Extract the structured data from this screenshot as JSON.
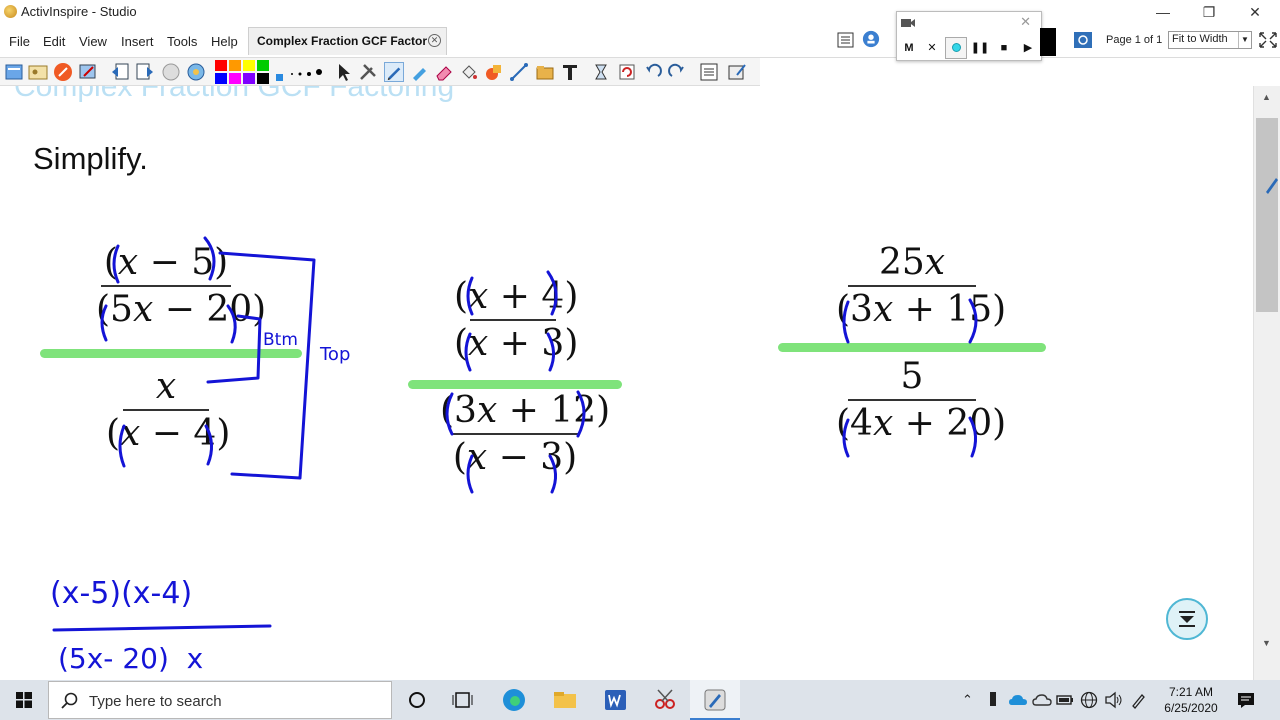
{
  "window": {
    "title": "ActivInspire - Studio",
    "controls": [
      "minimize",
      "restore",
      "close"
    ]
  },
  "menu": [
    "File",
    "Edit",
    "View",
    "Insert",
    "Tools",
    "Help"
  ],
  "tab": {
    "label": "Complex Fraction GCF Factoring"
  },
  "page_indicator": "Page 1 of 1",
  "zoom": {
    "selected": "Fit to Width"
  },
  "recorder": {
    "mute_label": "M",
    "close_label": "✕"
  },
  "toolbar": {
    "palette_colors": [
      "#ff0000",
      "#ff9900",
      "#ffff00",
      "#00cc00",
      "#0000ff",
      "#ff00ff",
      "#7f00ff",
      "#000000"
    ]
  },
  "canvas": {
    "heading": "Complex Fraction GCF Factoring",
    "instruction": "Simplify.",
    "problem1": {
      "top": {
        "num": "(x − 5)",
        "den": "(5x − 20)"
      },
      "bottom": {
        "num": "x",
        "den": "(x − 4)"
      },
      "annotation_btm": "Btm",
      "annotation_top": "Top"
    },
    "problem2": {
      "top": {
        "num": "(x + 4)",
        "den": "(x + 3)"
      },
      "bottom": {
        "num": "(3x + 12)",
        "den": "(x − 3)"
      }
    },
    "problem3": {
      "top": {
        "num": "25x",
        "den": "(3x + 15)"
      },
      "bottom": {
        "num": "5",
        "den": "(4x + 20)"
      }
    },
    "work": {
      "numerator": "(x-5)(x-4)",
      "denominator": "(5x- 20)  x"
    },
    "ink_color": "#1414d6",
    "highlight_color": "#7fe37b"
  },
  "taskbar": {
    "search_placeholder": "Type here to search",
    "time": "7:21 AM",
    "date": "6/25/2020"
  }
}
